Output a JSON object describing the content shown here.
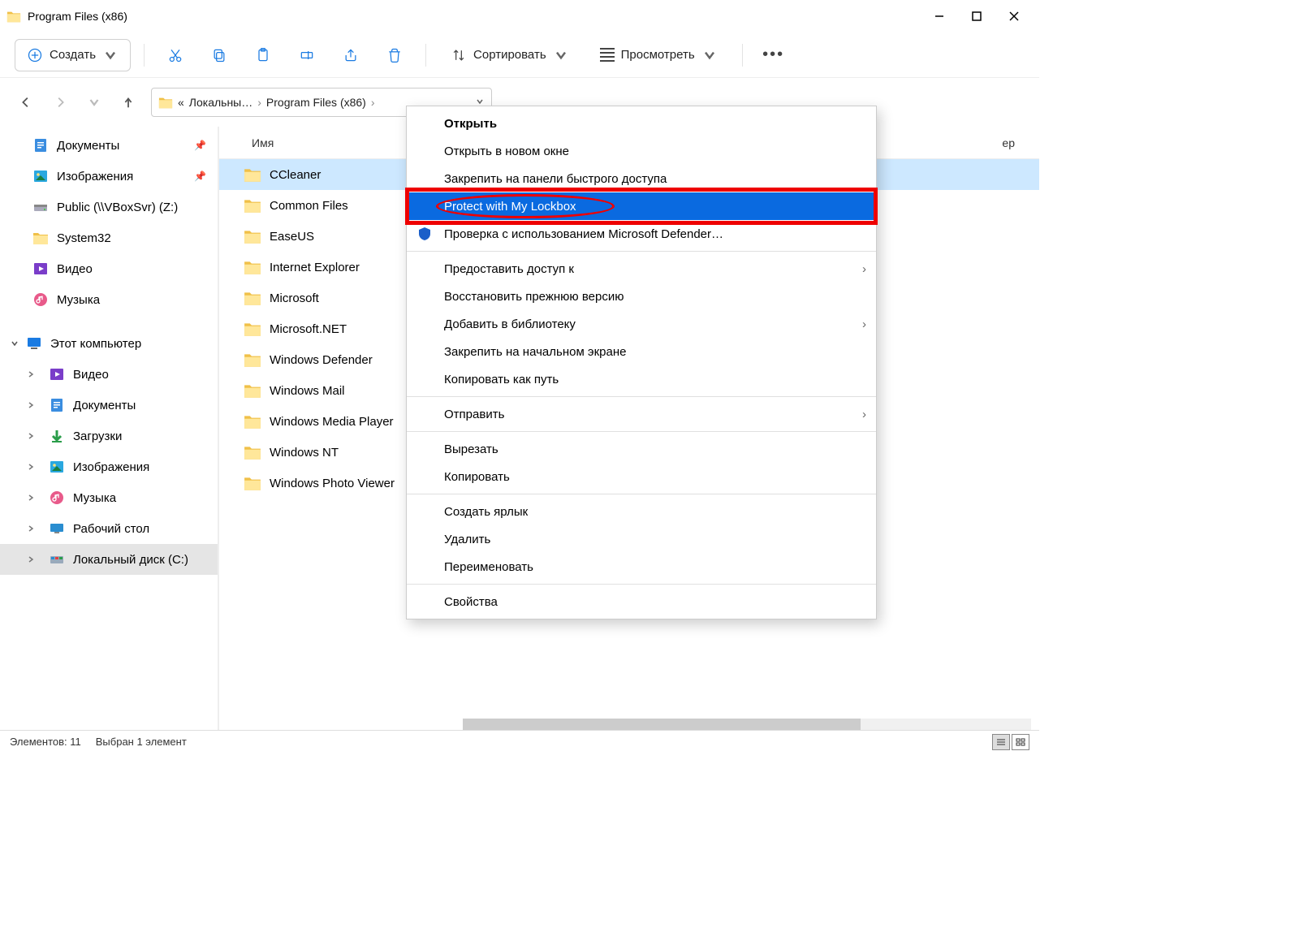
{
  "window": {
    "title": "Program Files (x86)",
    "min": "−",
    "max": "□",
    "close": "✕"
  },
  "toolbar": {
    "new": "Создать",
    "sort": "Сортировать",
    "view": "Просмотреть",
    "more": "…"
  },
  "breadcrumb": {
    "prefix": "«",
    "s1": "Локальны…",
    "s2": "Program Files (x86)"
  },
  "columns": {
    "name": "Имя",
    "size_hint": "ер"
  },
  "sidebar": [
    {
      "label": "Документы",
      "icon": "doc",
      "pinned": true
    },
    {
      "label": "Изображения",
      "icon": "img",
      "pinned": true
    },
    {
      "label": "Public (\\\\VBoxSvr) (Z:)",
      "icon": "drive",
      "pinned": false
    },
    {
      "label": "System32",
      "icon": "folder",
      "pinned": false
    },
    {
      "label": "Видео",
      "icon": "video",
      "pinned": false
    },
    {
      "label": "Музыка",
      "icon": "music",
      "pinned": false
    }
  ],
  "tree": {
    "root": "Этот компьютер",
    "items": [
      {
        "label": "Видео",
        "icon": "video"
      },
      {
        "label": "Документы",
        "icon": "doc"
      },
      {
        "label": "Загрузки",
        "icon": "down"
      },
      {
        "label": "Изображения",
        "icon": "img"
      },
      {
        "label": "Музыка",
        "icon": "music"
      },
      {
        "label": "Рабочий стол",
        "icon": "desk"
      },
      {
        "label": "Локальный диск (C:)",
        "icon": "cdrive",
        "selected": true
      }
    ]
  },
  "files": [
    {
      "name": "CCleaner",
      "selected": true
    },
    {
      "name": "Common Files"
    },
    {
      "name": "EaseUS"
    },
    {
      "name": "Internet Explorer"
    },
    {
      "name": "Microsoft"
    },
    {
      "name": "Microsoft.NET"
    },
    {
      "name": "Windows Defender"
    },
    {
      "name": "Windows Mail"
    },
    {
      "name": "Windows Media Player"
    },
    {
      "name": "Windows NT"
    },
    {
      "name": "Windows Photo Viewer"
    }
  ],
  "context": [
    {
      "label": "Открыть",
      "bold": true
    },
    {
      "label": "Открыть в новом окне"
    },
    {
      "label": "Закрепить на панели быстрого доступа"
    },
    {
      "label": "Protect with My Lockbox",
      "highlight": true,
      "boxed": true
    },
    {
      "label": "Проверка с использованием Microsoft Defender…",
      "icon": "shield"
    },
    {
      "sep": true
    },
    {
      "label": "Предоставить доступ к",
      "submenu": true
    },
    {
      "label": "Восстановить прежнюю версию"
    },
    {
      "label": "Добавить в библиотеку",
      "submenu": true
    },
    {
      "label": "Закрепить на начальном экране"
    },
    {
      "label": "Копировать как путь"
    },
    {
      "sep": true
    },
    {
      "label": "Отправить",
      "submenu": true
    },
    {
      "sep": true
    },
    {
      "label": "Вырезать"
    },
    {
      "label": "Копировать"
    },
    {
      "sep": true
    },
    {
      "label": "Создать ярлык"
    },
    {
      "label": "Удалить"
    },
    {
      "label": "Переименовать"
    },
    {
      "sep": true
    },
    {
      "label": "Свойства"
    }
  ],
  "status": {
    "count": "Элементов: 11",
    "selected": "Выбран 1 элемент"
  }
}
